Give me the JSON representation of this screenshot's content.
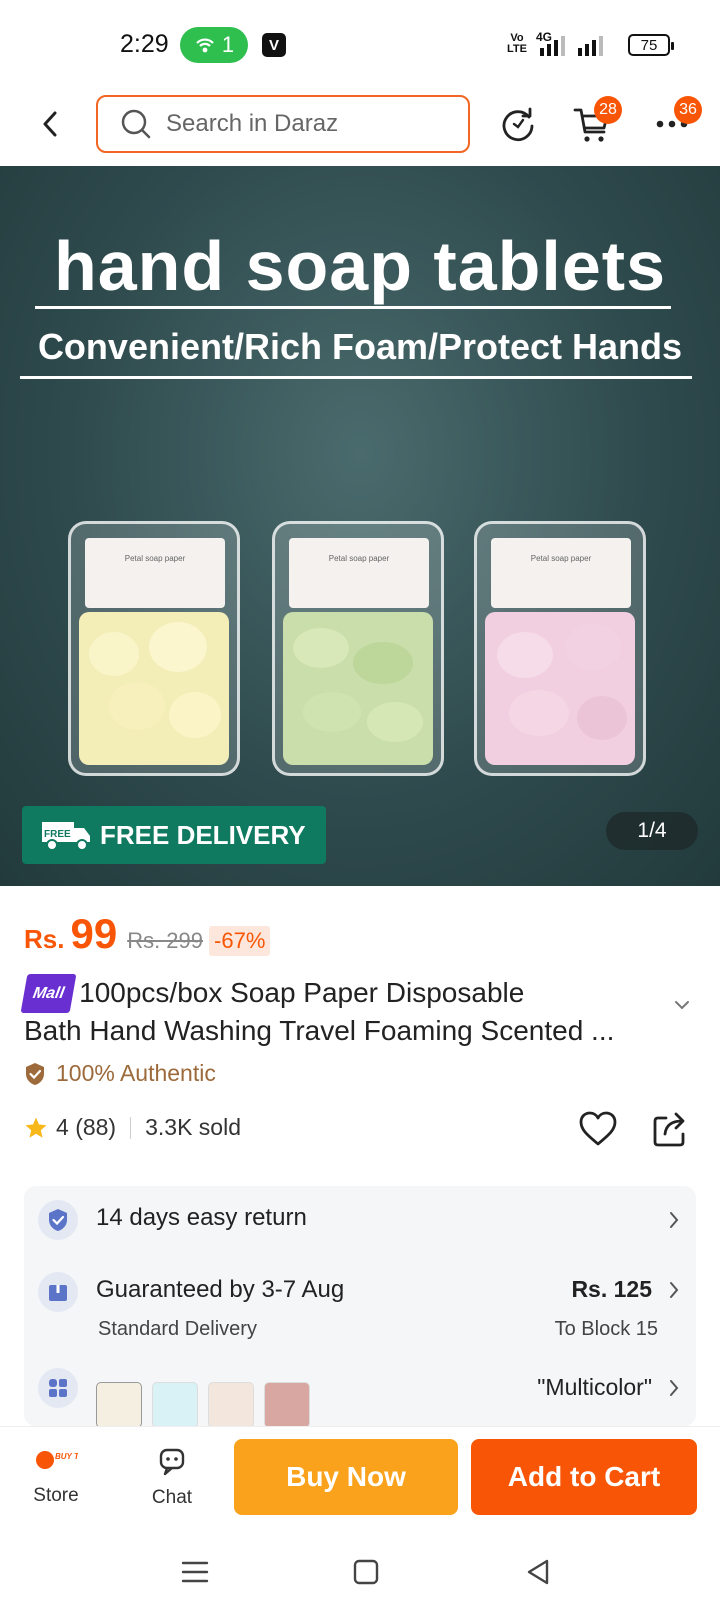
{
  "status_bar": {
    "time": "2:29",
    "hotspot_count": "1",
    "v_label": "V",
    "volte_label": "Vo LTE",
    "network_label": "4G",
    "battery": "75"
  },
  "top_nav": {
    "search_placeholder": "Search in Daraz",
    "cart_count": "28",
    "more_count": "36"
  },
  "hero": {
    "title": "hand soap tablets",
    "subtitle": "Convenient/Rich Foam/Protect Hands",
    "box_label": "Petal soap paper",
    "free_delivery_icon_text": "FREE",
    "free_delivery_label": "FREE DELIVERY",
    "image_counter": "1/4"
  },
  "price": {
    "currency": "Rs.",
    "current": "99",
    "original": "Rs. 299",
    "discount": "-67%"
  },
  "product": {
    "mall_badge": "Mall",
    "title_line1": "100pcs/box Soap Paper Disposable",
    "title_line2": "Bath Hand Washing Travel Foaming Scented ...",
    "authentic_label": "100% Authentic",
    "rating": "4",
    "review_count": "(88)",
    "sold": "3.3K sold"
  },
  "info": {
    "return_label": "14 days easy return",
    "delivery_label": "Guaranteed by 3-7 Aug",
    "delivery_type": "Standard Delivery",
    "delivery_price": "Rs. 125",
    "delivery_location": "To Block 15",
    "variant_label": "\"Multicolor\""
  },
  "actions": {
    "store_label": "Store",
    "store_logo_text": "BUY Today",
    "chat_label": "Chat",
    "buy_now": "Buy Now",
    "add_to_cart": "Add to Cart"
  },
  "colors": {
    "brand_orange": "#f85606",
    "buy_now_yellow": "#faa21b",
    "free_delivery_green": "#0f7a5f",
    "mall_purple": "#6a2fd0",
    "authentic_brown": "#9d6a3b"
  }
}
